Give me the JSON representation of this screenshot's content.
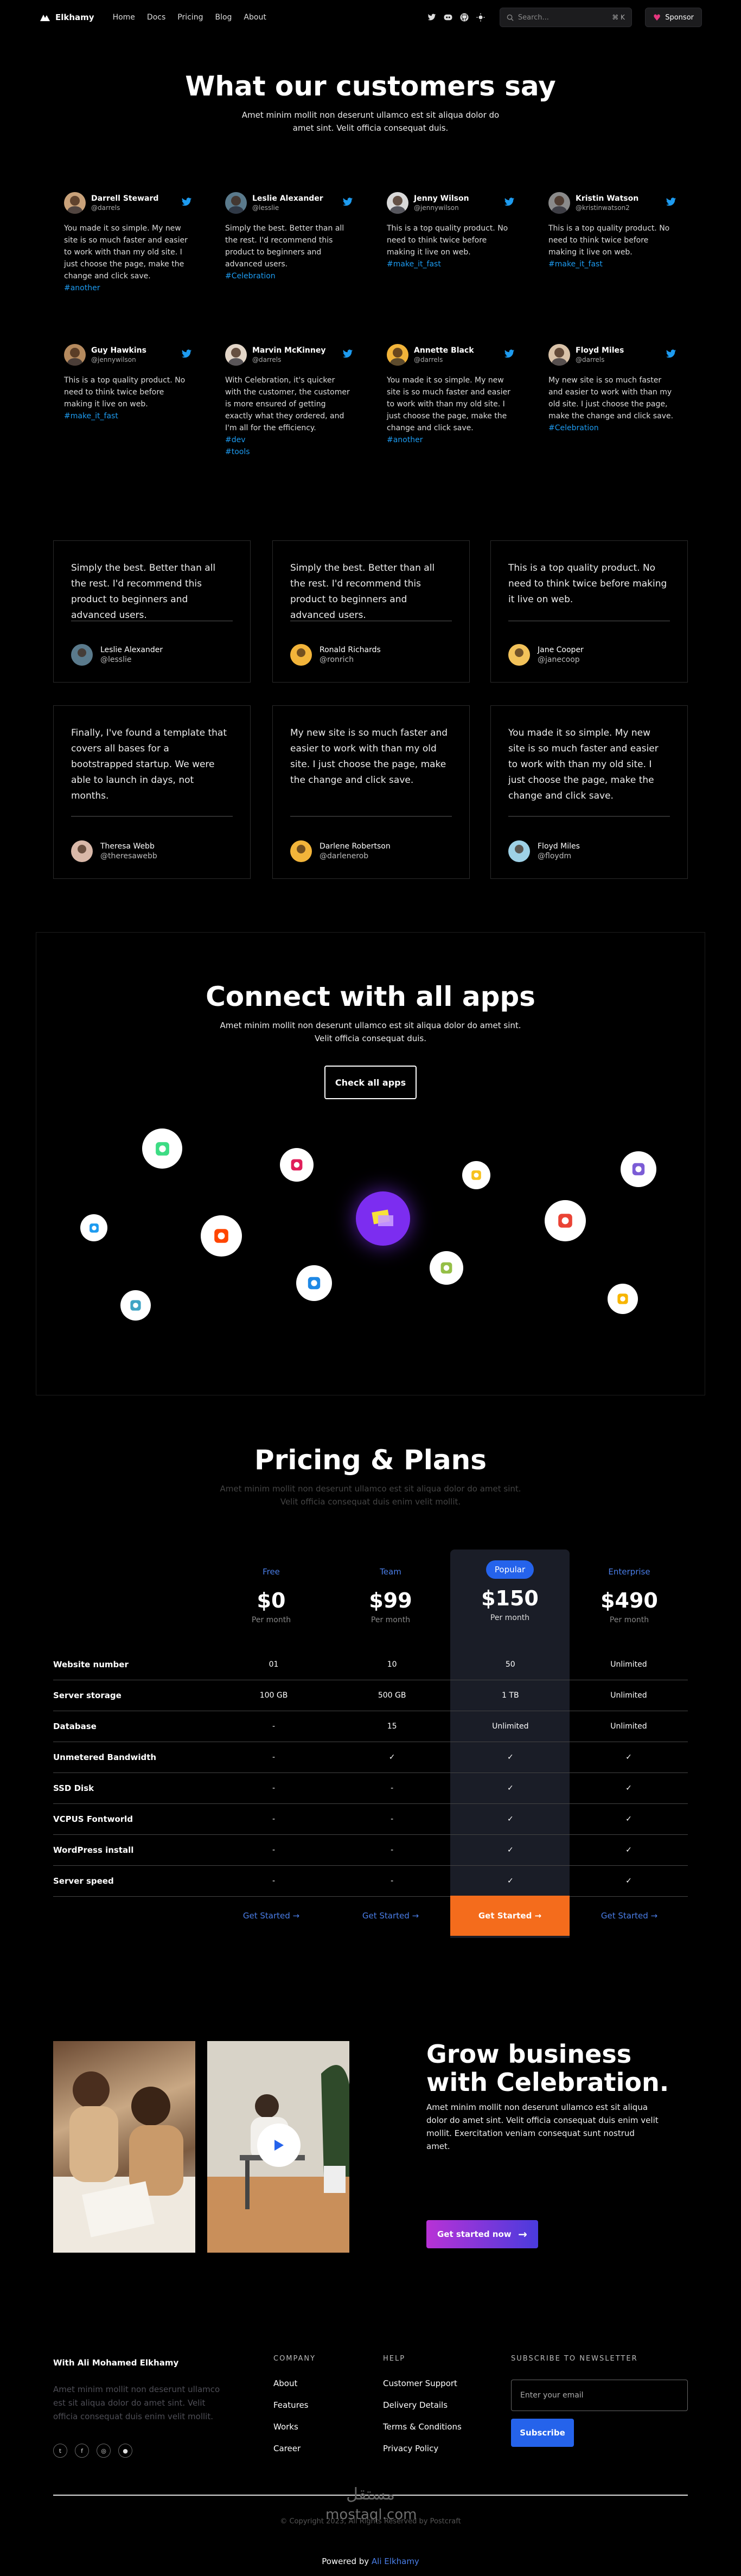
{
  "nav": {
    "brand": "Elkhamy",
    "links": [
      "Home",
      "Docs",
      "Pricing",
      "Blog",
      "About"
    ],
    "search_placeholder": "Search...",
    "search_kbd": "⌘ K",
    "sponsor_label": "Sponsor"
  },
  "testimonials": {
    "title": "What our customers say",
    "subtitle": "Amet minim mollit non deserunt ullamco est sit aliqua dolor do amet sint. Velit officia consequat duis.",
    "tweets": [
      {
        "name": "Darrell Steward",
        "handle": "@darrels",
        "text": "You made it so simple. My new site is so much faster and easier to work with than my old site. I just choose the page, make the change and click save.",
        "tags": [
          "#another"
        ],
        "avatar_color": "#c9a27a"
      },
      {
        "name": "Leslie Alexander",
        "handle": "@lesslie",
        "text": "Simply the best. Better than all the rest. I'd recommend this product to beginners and advanced users.",
        "tags": [
          "#Celebration"
        ],
        "avatar_color": "#5a7a8c"
      },
      {
        "name": "Jenny Wilson",
        "handle": "@jennywilson",
        "text": "This is a top quality product. No need to think twice before making it live on web.",
        "tags": [
          "#make_it_fast"
        ],
        "avatar_color": "#d9d9d9"
      },
      {
        "name": "Kristin Watson",
        "handle": "@kristinwatson2",
        "text": "This is a top quality product. No need to think twice before making it live on web.",
        "tags": [
          "#make_it_fast"
        ],
        "avatar_color": "#8a8a8a"
      },
      {
        "name": "Guy Hawkins",
        "handle": "@jennywilson",
        "text": "This is a top quality product. No need to think twice before making it live on web.",
        "tags": [
          "#make_it_fast"
        ],
        "avatar_color": "#b58a5e"
      },
      {
        "name": "Marvin McKinney",
        "handle": "@darrels",
        "text": "With Celebration, it's quicker with the customer, the customer is more ensured of getting exactly what they ordered, and I'm all for the efficiency.",
        "tags": [
          "#dev",
          "#tools"
        ],
        "avatar_color": "#e3d6c8"
      },
      {
        "name": "Annette Black",
        "handle": "@darrels",
        "text": "You made it so simple. My new site is so much faster and easier to work with than my old site. I just choose the page, make the change and click save.",
        "tags": [
          "#another"
        ],
        "avatar_color": "#f2b43a"
      },
      {
        "name": "Floyd Miles",
        "handle": "@darrels",
        "text": "My new site is so much faster and easier to work with than my old site. I just choose the page, make the change and click save.",
        "tags": [
          "#Celebration"
        ],
        "avatar_color": "#d9c2a8"
      }
    ],
    "quotes": [
      {
        "text": "Simply the best. Better than all the rest. I'd recommend this product to beginners and advanced users.",
        "name": "Leslie Alexander",
        "handle": "@lesslie",
        "avatar_color": "#5a7a8c"
      },
      {
        "text": "Simply the best. Better than all the rest. I'd recommend this product to beginners and advanced users.",
        "name": "Ronald Richards",
        "handle": "@ronrich",
        "avatar_color": "#f2b43a"
      },
      {
        "text": "This is a top quality product. No need to think twice before making it live on web.",
        "name": "Jane Cooper",
        "handle": "@janecoop",
        "avatar_color": "#f2c25a"
      },
      {
        "text": "Finally, I've found a template that covers all bases for a bootstrapped startup. We were able to launch in days, not months.",
        "name": "Theresa Webb",
        "handle": "@theresawebb",
        "avatar_color": "#d9b8a8"
      },
      {
        "text": "My new site is so much faster and easier to work with than my old site. I just choose the page, make the change and click save.",
        "name": "Darlene Robertson",
        "handle": "@darlenerob",
        "avatar_color": "#f2b43a"
      },
      {
        "text": "You made it so simple. My new site is so much faster and easier to work with than my old site. I just choose the page, make the change and click save.",
        "name": "Floyd Miles",
        "handle": "@floydm",
        "avatar_color": "#9ed1e6"
      }
    ]
  },
  "connect": {
    "title": "Connect with all apps",
    "subtitle": "Amet minim mollit non deserunt ullamco est sit aliqua dolor do amet sint. Velit officia consequat duis.",
    "button": "Check all apps",
    "apps": [
      {
        "name": "android-icon",
        "color": "#3ddc84",
        "size": 74
      },
      {
        "name": "slack-icon",
        "color": "#e01e5a",
        "size": 62
      },
      {
        "name": "bumble-icon",
        "color": "#f7c21d",
        "size": 52
      },
      {
        "name": "docs-icon",
        "color": "#7b5cd6",
        "size": 66
      },
      {
        "name": "twitter-icon",
        "color": "#1d9bf0",
        "size": 50
      },
      {
        "name": "reddit-icon",
        "color": "#ff4500",
        "size": 76
      },
      {
        "name": "celebration-icon",
        "color": "#8b3cf0",
        "size": 100
      },
      {
        "name": "gmail-icon",
        "color": "#ea4335",
        "size": 76
      },
      {
        "name": "vscode-icon",
        "color": "#1e88e5",
        "size": 66
      },
      {
        "name": "shopify-icon",
        "color": "#95bf47",
        "size": 62
      },
      {
        "name": "sketch-icon",
        "color": "#f7b500",
        "size": 56
      },
      {
        "name": "periscope-icon",
        "color": "#40a4c4",
        "size": 56
      }
    ]
  },
  "pricing": {
    "title": "Pricing & Plans",
    "subtitle": "Amet minim mollit non deserunt ullamco est sit aliqua dolor do amet sint. Velit officia consequat duis enim velit mollit.",
    "plans": [
      {
        "tier": "Free",
        "price": "$0",
        "per": "Per month"
      },
      {
        "tier": "Team",
        "price": "$99",
        "per": "Per month"
      },
      {
        "tier": "Popular",
        "price": "$150",
        "per": "Per month"
      },
      {
        "tier": "Enterprise",
        "price": "$490",
        "per": "Per month"
      }
    ],
    "features": [
      {
        "label": "Website number",
        "values": [
          "01",
          "10",
          "50",
          "Unlimited"
        ]
      },
      {
        "label": "Server storage",
        "values": [
          "100 GB",
          "500 GB",
          "1 TB",
          "Unlimited"
        ]
      },
      {
        "label": "Database",
        "values": [
          "-",
          "15",
          "Unlimited",
          "Unlimited"
        ]
      },
      {
        "label": "Unmetered Bandwidth",
        "values": [
          "-",
          "✓",
          "✓",
          "✓"
        ]
      },
      {
        "label": "SSD Disk",
        "values": [
          "-",
          "-",
          "✓",
          "✓"
        ]
      },
      {
        "label": "VCPUS Fontworld",
        "values": [
          "-",
          "-",
          "✓",
          "✓"
        ]
      },
      {
        "label": "WordPress install",
        "values": [
          "-",
          "-",
          "✓",
          "✓"
        ]
      },
      {
        "label": "Server speed",
        "values": [
          "-",
          "-",
          "✓",
          "✓"
        ]
      }
    ],
    "cta": "Get Started →"
  },
  "grow": {
    "title_line1": "Grow business",
    "title_line2": "with Celebration.",
    "text": "Amet minim mollit non deserunt ullamco est sit aliqua dolor do amet sint. Velit officia consequat duis enim velit mollit. Exercitation veniam consequat sunt nostrud amet.",
    "button": "Get started now"
  },
  "footer": {
    "brand": "With Ali Mohamed Elkhamy",
    "desc": "Amet minim mollit non deserunt ullamco est sit aliqua dolor do amet sint. Velit officia consequat duis enim velit mollit.",
    "company_title": "COMPANY",
    "company_links": [
      "About",
      "Features",
      "Works",
      "Career"
    ],
    "help_title": "HELP",
    "help_links": [
      "Customer Support",
      "Delivery Details",
      "Terms & Conditions",
      "Privacy Policy"
    ],
    "newsletter_title": "SUBSCRIBE TO NEWSLETTER",
    "email_placeholder": "Enter your email",
    "subscribe": "Subscribe",
    "socials": [
      "twitter-icon",
      "facebook-icon",
      "instagram-icon",
      "github-icon"
    ],
    "copyright": "© Copyright 2023, All Rights Reserved by Postcraft",
    "watermark": "مستقل",
    "watermark_sub": "mostaql.com",
    "powered_prefix": "Powered by",
    "powered_link": "Ali Elkhamy"
  }
}
